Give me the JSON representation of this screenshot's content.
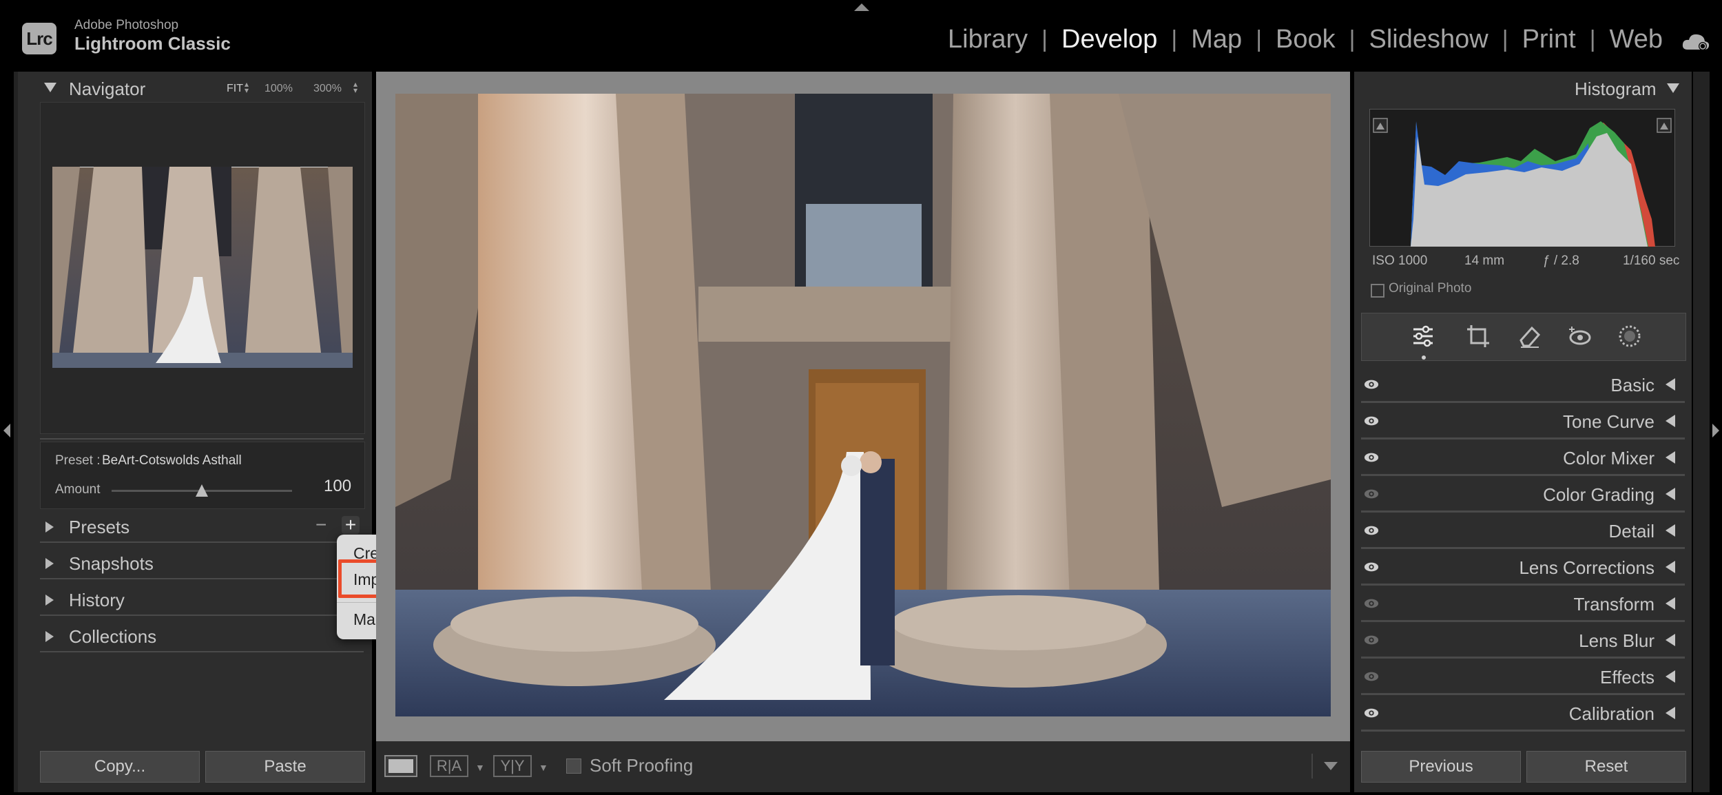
{
  "app": {
    "brand_line1": "Adobe Photoshop",
    "brand_line2": "Lightroom Classic",
    "logo_text": "Lrc"
  },
  "modules": [
    "Library",
    "Develop",
    "Map",
    "Book",
    "Slideshow",
    "Print",
    "Web"
  ],
  "active_module": "Develop",
  "navigator": {
    "title": "Navigator",
    "zoom_fit": "FIT",
    "zoom_100": "100%",
    "zoom_300": "300%"
  },
  "preset_info": {
    "label": "Preset :",
    "name": "BeArt-Cotswolds Asthall",
    "amount_label": "Amount",
    "amount_value": "100",
    "amount_fraction": 0.5
  },
  "left_sections": {
    "presets": "Presets",
    "snapshots": "Snapshots",
    "history": "History",
    "collections": "Collections"
  },
  "preset_controls": {
    "minus": "−",
    "plus": "+"
  },
  "context_menu": {
    "create": "Create Preset...",
    "import": "Import Presets...",
    "manage": "Manage Presets..."
  },
  "left_buttons": {
    "copy": "Copy...",
    "paste": "Paste"
  },
  "toolbar": {
    "soft_proofing": "Soft Proofing",
    "compare_ra": "R|A",
    "compare_yy": "Y|Y"
  },
  "histogram": {
    "title": "Histogram",
    "iso": "ISO 1000",
    "focal": "14 mm",
    "aperture": "ƒ / 2.8",
    "shutter": "1/160 sec",
    "original_photo": "Original Photo"
  },
  "tools": [
    "edit-sliders-icon",
    "crop-icon",
    "healing-eraser-icon",
    "red-eye-icon",
    "masking-icon"
  ],
  "right_panels": [
    "Basic",
    "Tone Curve",
    "Color Mixer",
    "Color Grading",
    "Detail",
    "Lens Corrections",
    "Transform",
    "Lens Blur",
    "Effects",
    "Calibration"
  ],
  "right_buttons": {
    "previous": "Previous",
    "reset": "Reset"
  },
  "colors": {
    "highlight": "#ea4b2a",
    "panel": "#2d2d2d",
    "center_bg": "#878787"
  }
}
